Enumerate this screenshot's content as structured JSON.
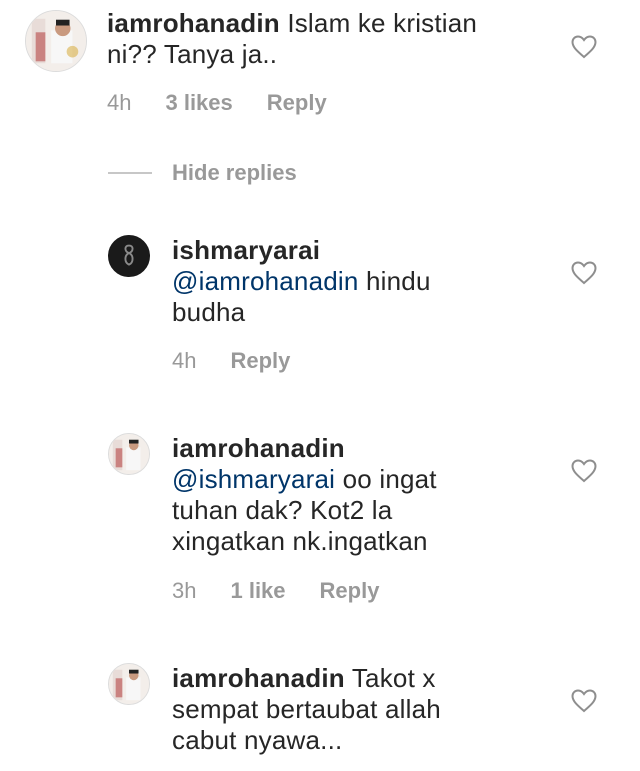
{
  "comments": [
    {
      "username": "iamrohanadin",
      "mention": "",
      "text_line1": "Islam ke kristian",
      "text_line2": "ni?? Tanya ja..",
      "text_line3": "",
      "time": "4h",
      "likes": "3 likes",
      "reply": "Reply"
    },
    {
      "username": "ishmaryarai",
      "mention": "@iamrohanadin",
      "text_line1": "hindu",
      "text_line2": "budha",
      "time": "4h",
      "likes": "",
      "reply": "Reply"
    },
    {
      "username": "iamrohanadin",
      "mention": "@ishmaryarai",
      "text_line1": "oo ingat",
      "text_line2": "tuhan dak? Kot2 la",
      "text_line3": "xingatkan nk.ingatkan",
      "time": "3h",
      "likes": "1 like",
      "reply": "Reply"
    },
    {
      "username": "iamrohanadin",
      "mention": "",
      "text_line1": "Takot x",
      "text_line2": "sempat bertaubat allah",
      "text_line3": "cabut nyawa...",
      "time": "",
      "likes": "",
      "reply": ""
    }
  ],
  "hide_replies_label": "Hide replies",
  "colors": {
    "text": "#262626",
    "mention": "#003569",
    "meta": "#999999",
    "divider": "#c7c7c7"
  },
  "icons": {
    "like": "heart-outline-icon"
  }
}
